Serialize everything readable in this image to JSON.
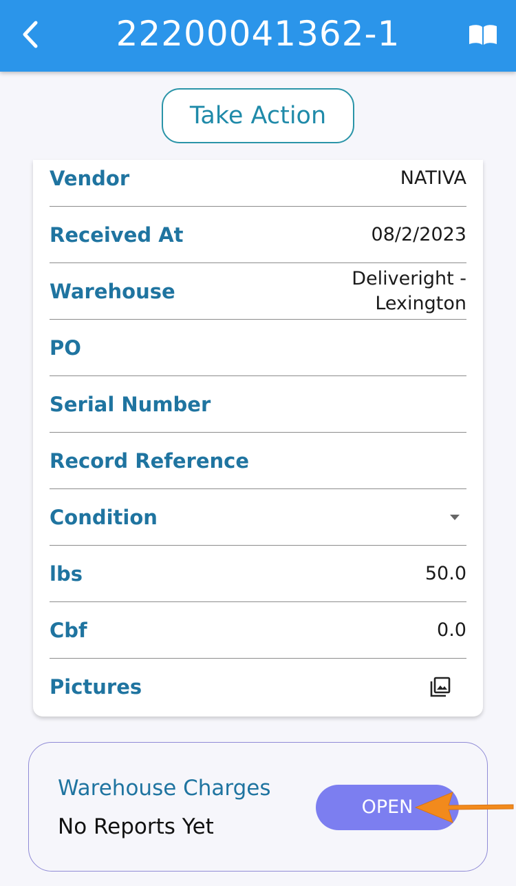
{
  "header": {
    "title": "22200041362-1",
    "back_icon": "chevron-left-icon",
    "book_icon": "book-icon",
    "color": "#2b95ea"
  },
  "take_action_label": "Take Action",
  "details": [
    {
      "label": "Vendor",
      "value": "NATIVA"
    },
    {
      "label": "Received At",
      "value": "08/2/2023"
    },
    {
      "label": "Warehouse",
      "value": "Deliveright - Lexington"
    },
    {
      "label": "PO",
      "value": ""
    },
    {
      "label": "Serial Number",
      "value": ""
    },
    {
      "label": "Record Reference",
      "value": ""
    },
    {
      "label": "Condition",
      "value": ""
    },
    {
      "label": "lbs",
      "value": "50.0"
    },
    {
      "label": "Cbf",
      "value": "0.0"
    },
    {
      "label": "Pictures",
      "value": ""
    }
  ],
  "warehouse_charges": {
    "title": "Warehouse Charges",
    "status": "No Reports Yet",
    "open_label": "OPEN",
    "accent": "#7c7ef0"
  }
}
